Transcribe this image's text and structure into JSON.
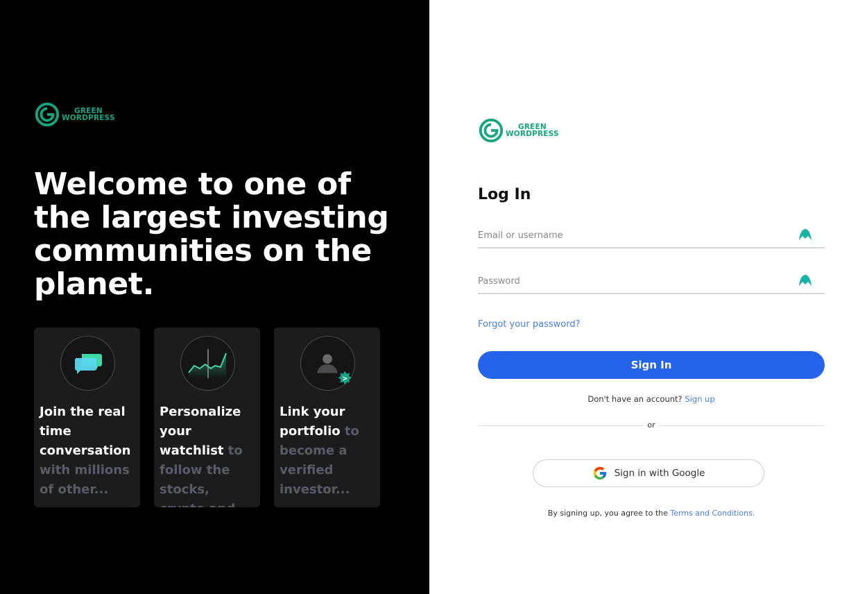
{
  "brand": {
    "line1": "GREEN",
    "line2": "WORDPRESS",
    "color": "#17a57f"
  },
  "hero": {
    "headline": "Welcome to one of the largest investing communities on the planet."
  },
  "cards": [
    {
      "icon": "chat-bubbles-icon",
      "highlight": "Join the real time conversation",
      "rest": " with millions of other..."
    },
    {
      "icon": "line-chart-icon",
      "highlight": "Personalize your watchlist",
      "rest": " to follow the stocks, crypto and assets y..."
    },
    {
      "icon": "verified-user-icon",
      "highlight": "Link your portfolio",
      "rest": " to become a verified investor..."
    }
  ],
  "login": {
    "title": "Log In",
    "email_placeholder": "Email or username",
    "password_placeholder": "Password",
    "forgot": "Forgot your password?",
    "signin_label": "Sign In",
    "no_account": "Don't have an account?",
    "signup": "Sign up",
    "or": "or",
    "google_label": "Sign in with Google",
    "terms_prefix": "By signing up, you agree to the",
    "terms_link": "Terms and Conditions."
  },
  "colors": {
    "primary": "#2563eb",
    "link": "#4a7fe0",
    "left_bg": "#000000",
    "card_bg": "#1c1c1e"
  }
}
